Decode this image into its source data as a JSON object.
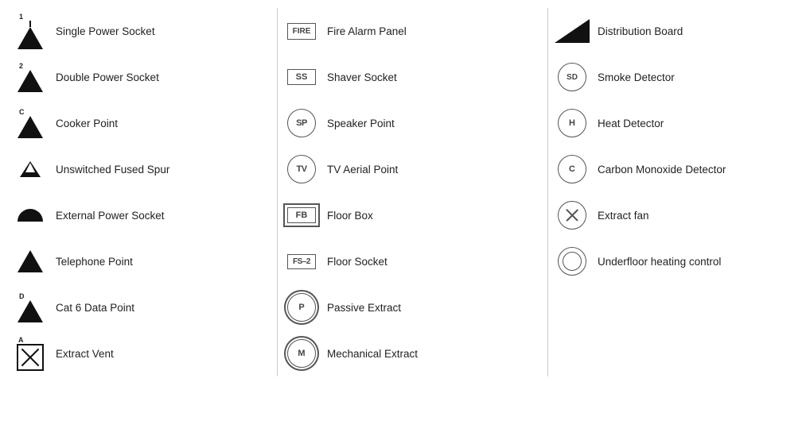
{
  "col1": {
    "items": [
      {
        "id": "single-power-socket",
        "label": "Single Power Socket",
        "symbol": "tri-1"
      },
      {
        "id": "double-power-socket",
        "label": "Double Power Socket",
        "symbol": "tri-2"
      },
      {
        "id": "cooker-point",
        "label": "Cooker Point",
        "symbol": "tri-c"
      },
      {
        "id": "unswitched-fused-spur",
        "label": "Unswitched Fused Spur",
        "symbol": "tri-small"
      },
      {
        "id": "external-power-socket",
        "label": "External Power Socket",
        "symbol": "dome"
      },
      {
        "id": "telephone-point",
        "label": "Telephone Point",
        "symbol": "tri-filled"
      },
      {
        "id": "cat6-data-point",
        "label": "Cat 6 Data Point",
        "symbol": "tri-d"
      },
      {
        "id": "extract-vent",
        "label": "Extract Vent",
        "symbol": "box-x"
      }
    ]
  },
  "col2": {
    "items": [
      {
        "id": "fire-alarm-panel",
        "label": "Fire Alarm Panel",
        "symbol": "box-fire",
        "text": "FIRE"
      },
      {
        "id": "shaver-socket",
        "label": "Shaver Socket",
        "symbol": "box-ss",
        "text": "SS"
      },
      {
        "id": "speaker-point",
        "label": "Speaker Point",
        "symbol": "circle-sp",
        "text": "SP"
      },
      {
        "id": "tv-aerial-point",
        "label": "TV Aerial Point",
        "symbol": "circle-tv",
        "text": "TV"
      },
      {
        "id": "floor-box",
        "label": "Floor Box",
        "symbol": "box-fb",
        "text": "FB"
      },
      {
        "id": "floor-socket",
        "label": "Floor Socket",
        "symbol": "box-fs2",
        "text": "FS-2"
      },
      {
        "id": "passive-extract",
        "label": "Passive Extract",
        "symbol": "dbl-circle-p",
        "text": "P"
      },
      {
        "id": "mechanical-extract",
        "label": "Mechanical Extract",
        "symbol": "dbl-circle-m",
        "text": "M"
      }
    ]
  },
  "col3": {
    "items": [
      {
        "id": "distribution-board",
        "label": "Distribution Board",
        "symbol": "dist-board"
      },
      {
        "id": "smoke-detector",
        "label": "Smoke Detector",
        "symbol": "circle-sd",
        "text": "SD"
      },
      {
        "id": "heat-detector",
        "label": "Heat Detector",
        "symbol": "circle-h",
        "text": "H"
      },
      {
        "id": "carbon-monoxide-detector",
        "label": "Carbon Monoxide Detector",
        "symbol": "circle-c",
        "text": "C"
      },
      {
        "id": "extract-fan",
        "label": "Extract fan",
        "symbol": "circle-x"
      },
      {
        "id": "underfloor-heating-control",
        "label": "Underfloor heating control",
        "symbol": "dbl-circle-empty"
      }
    ]
  }
}
